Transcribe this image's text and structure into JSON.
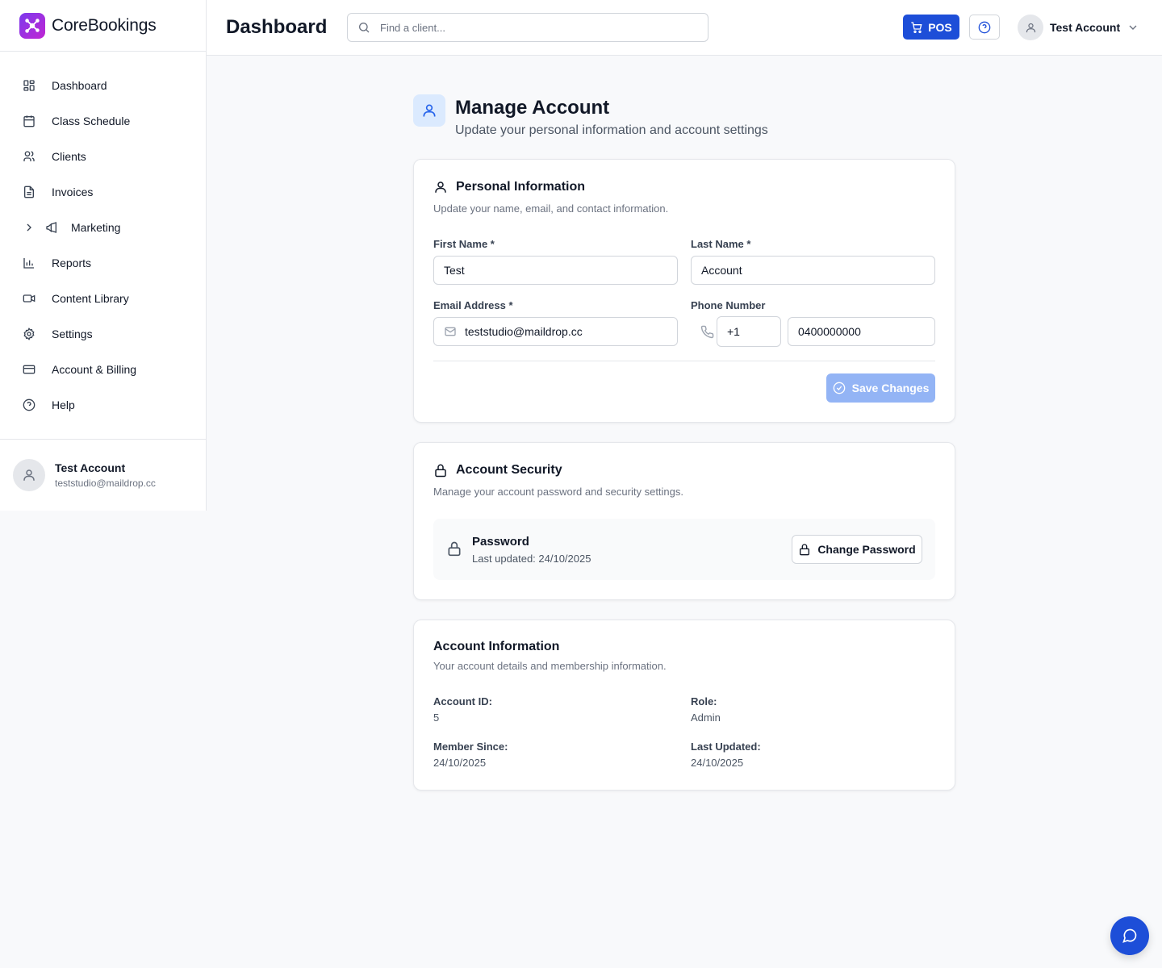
{
  "app": {
    "name": "CoreBookings"
  },
  "sidebar": {
    "items": [
      {
        "label": "Dashboard",
        "icon": "dashboard-grid-icon"
      },
      {
        "label": "Class Schedule",
        "icon": "calendar-icon"
      },
      {
        "label": "Clients",
        "icon": "users-icon"
      },
      {
        "label": "Invoices",
        "icon": "document-icon"
      },
      {
        "label": "Marketing",
        "icon": "megaphone-icon"
      },
      {
        "label": "Reports",
        "icon": "bar-chart-icon"
      },
      {
        "label": "Content Library",
        "icon": "video-icon"
      },
      {
        "label": "Settings",
        "icon": "gear-icon"
      },
      {
        "label": "Account & Billing",
        "icon": "credit-card-icon"
      },
      {
        "label": "Help",
        "icon": "help-circle-icon"
      }
    ],
    "user": {
      "name": "Test Account",
      "email": "teststudio@maildrop.cc"
    }
  },
  "header": {
    "title": "Dashboard",
    "search_placeholder": "Find a client...",
    "pos_label": "POS",
    "account_label": "Test Account"
  },
  "page": {
    "title": "Manage Account",
    "subtitle": "Update your personal information and account settings"
  },
  "personal": {
    "title": "Personal Information",
    "description": "Update your name, email, and contact information.",
    "first_name_label": "First Name *",
    "first_name": "Test",
    "last_name_label": "Last Name *",
    "last_name": "Account",
    "email_label": "Email Address *",
    "email": "teststudio@maildrop.cc",
    "phone_label": "Phone Number",
    "country_code": "+1",
    "phone": "0400000000",
    "save_label": "Save Changes"
  },
  "security": {
    "title": "Account Security",
    "description": "Manage your account password and security settings.",
    "password_title": "Password",
    "password_updated": "Last updated: 24/10/2025",
    "change_label": "Change Password"
  },
  "account_info": {
    "title": "Account Information",
    "description": "Your account details and membership information.",
    "account_id_label": "Account ID:",
    "account_id": "5",
    "role_label": "Role:",
    "role": "Admin",
    "member_since_label": "Member Since:",
    "member_since": "24/10/2025",
    "last_updated_label": "Last Updated:",
    "last_updated": "24/10/2025"
  },
  "colors": {
    "primary": "#1d4ed8",
    "save_disabled": "#93b4f5",
    "icon_bg": "#dbeafe"
  }
}
